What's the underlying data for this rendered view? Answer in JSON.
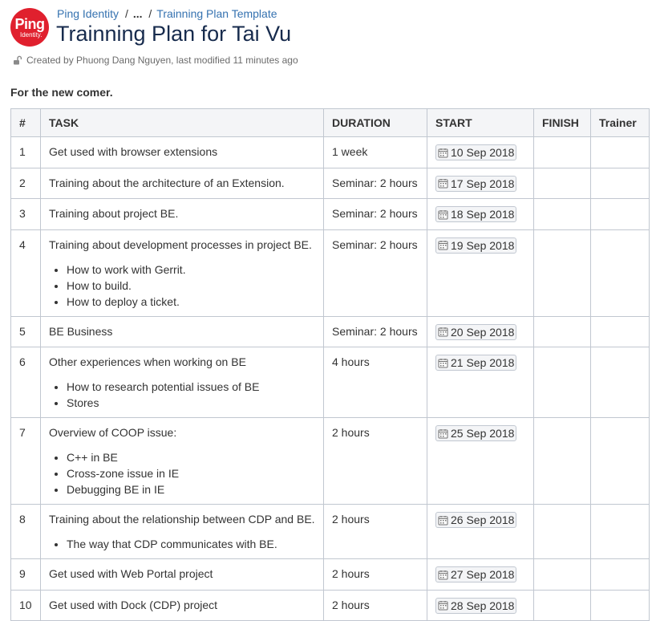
{
  "brand": {
    "logo_line1": "Ping",
    "logo_line2": "Identity.",
    "accent": "#e0202e"
  },
  "breadcrumbs": {
    "root": "Ping Identity",
    "sep1": "/",
    "ellipsis": "...",
    "sep2": "/",
    "parent": "Trainning Plan Template"
  },
  "page": {
    "title": "Trainning Plan for Tai Vu",
    "meta": "Created by Phuong Dang Nguyen, last modified 11 minutes ago",
    "intro": "For the new comer."
  },
  "table": {
    "headers": [
      "#",
      "TASK",
      "DURATION",
      "START",
      "FINISH",
      "Trainer"
    ],
    "rows": [
      {
        "num": "1",
        "task": "Get used with browser extensions",
        "bullets": [],
        "duration": "1 week",
        "start": "10 Sep 2018",
        "finish": "",
        "trainer": ""
      },
      {
        "num": "2",
        "task": "Training about the architecture of an Extension.",
        "bullets": [],
        "duration": "Seminar: 2 hours",
        "start": "17 Sep 2018",
        "finish": "",
        "trainer": ""
      },
      {
        "num": "3",
        "task": "Training about project BE.",
        "bullets": [],
        "duration": "Seminar: 2 hours",
        "start": "18 Sep 2018",
        "finish": "",
        "trainer": ""
      },
      {
        "num": "4",
        "task": "Training about development processes in project BE.",
        "bullets": [
          "How to work with Gerrit.",
          "How to build.",
          "How to deploy a ticket."
        ],
        "duration": "Seminar: 2 hours",
        "start": "19 Sep 2018",
        "finish": "",
        "trainer": ""
      },
      {
        "num": "5",
        "task": "BE Business",
        "bullets": [],
        "duration": "Seminar: 2 hours",
        "start": "20 Sep 2018",
        "finish": "",
        "trainer": ""
      },
      {
        "num": "6",
        "task": "Other experiences when working on BE",
        "bullets": [
          "How to research potential issues of BE",
          "Stores"
        ],
        "duration": "4 hours",
        "start": "21 Sep 2018",
        "finish": "",
        "trainer": ""
      },
      {
        "num": "7",
        "task": "Overview of COOP issue:",
        "bullets": [
          "C++ in BE",
          "Cross-zone issue in IE",
          "Debugging BE in IE"
        ],
        "duration": "2 hours",
        "start": "25 Sep 2018",
        "finish": "",
        "trainer": ""
      },
      {
        "num": "8",
        "task": "Training about the relationship between CDP and BE.",
        "bullets": [
          "The way that CDP communicates with BE."
        ],
        "duration": "2 hours",
        "start": "26 Sep 2018",
        "finish": "",
        "trainer": ""
      },
      {
        "num": "9",
        "task": "Get used with Web Portal project",
        "bullets": [],
        "duration": "2 hours",
        "start": "27 Sep 2018",
        "finish": "",
        "trainer": ""
      },
      {
        "num": "10",
        "task": "Get used with Dock (CDP) project",
        "bullets": [],
        "duration": "2 hours",
        "start": "28 Sep 2018",
        "finish": "",
        "trainer": ""
      }
    ]
  }
}
